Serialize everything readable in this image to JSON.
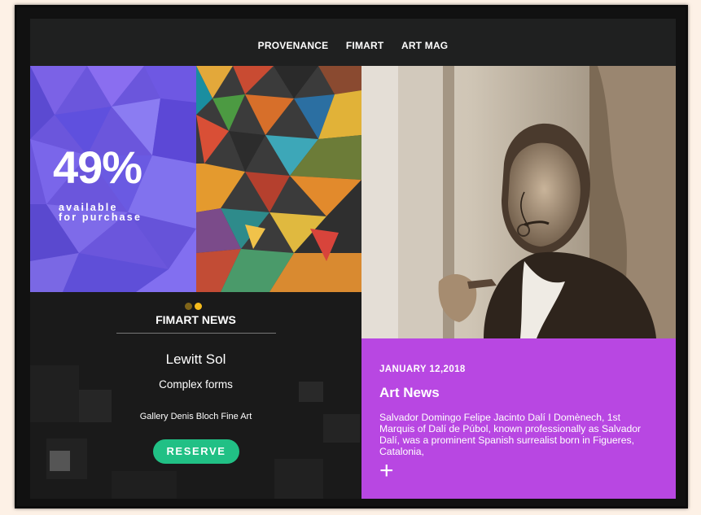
{
  "nav": {
    "items": [
      "PROVENANCE",
      "FIMART",
      "ART MAG"
    ]
  },
  "hero": {
    "stat": "49%",
    "stat_line1": "available",
    "stat_line2": "for purchase"
  },
  "news": {
    "dot_colors": [
      "#7f6419",
      "#f5bb1c"
    ],
    "title": "FIMART NEWS",
    "artist": "Lewitt Sol",
    "work": "Complex forms",
    "gallery": "Gallery Denis Bloch Fine Art",
    "reserve_label": "RESERVE"
  },
  "article": {
    "date": "JANUARY 12,2018",
    "title": "Art News",
    "body": "Salvador Domingo Felipe Jacinto Dalí I Domènech, 1st Marquis of Dalí de Púbol, known professionally as Salvador Dalí, was a prominent Spanish surrealist born in Figueres, Catalonia,",
    "plus": "+"
  },
  "colors": {
    "accent_purple": "#b847e2",
    "reserve_green": "#21c085",
    "dark_bg": "#1f2020"
  }
}
